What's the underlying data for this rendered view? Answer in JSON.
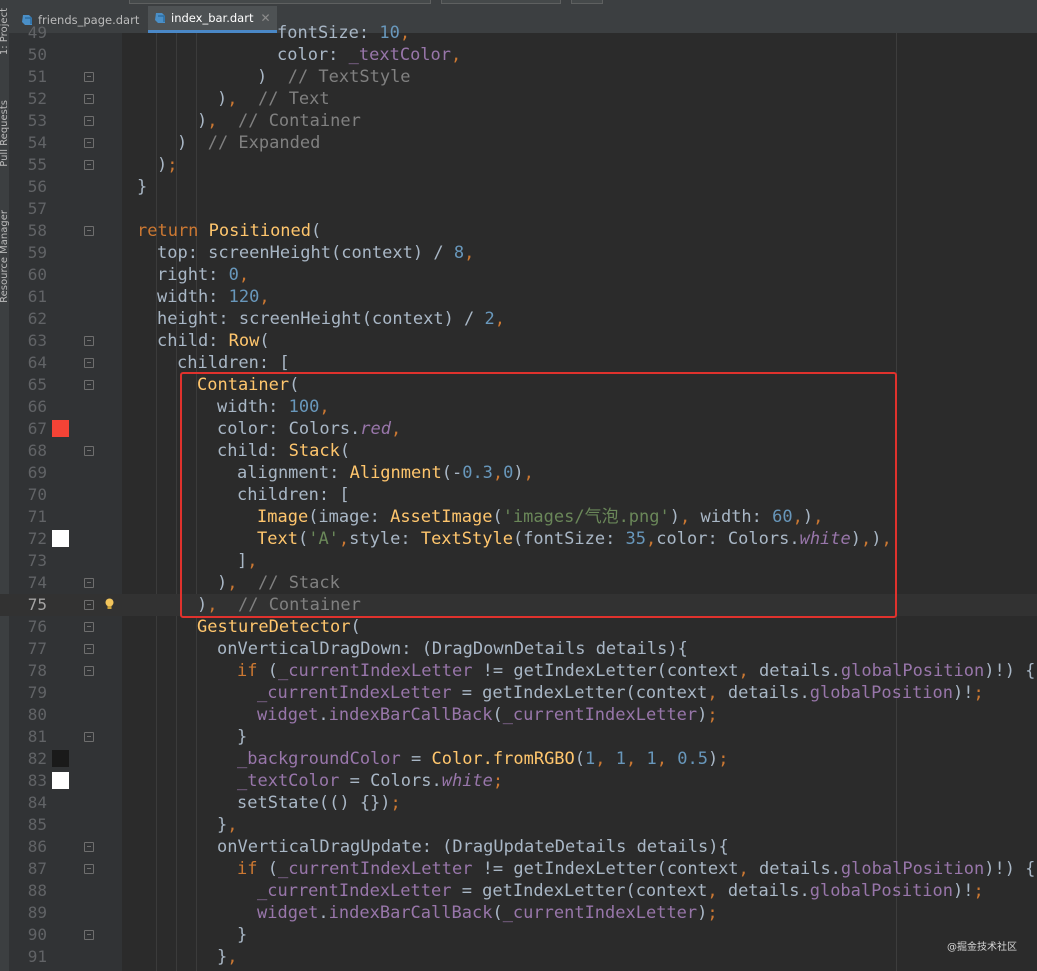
{
  "tool_window_labels": [
    "1: Project",
    "Pull Requests",
    "Resource Manager"
  ],
  "tabs": [
    {
      "label": "friends_page.dart",
      "active": false
    },
    {
      "label": "index_bar.dart",
      "active": true
    }
  ],
  "lines": [
    {
      "num": "49",
      "text": "            fontSize: 10,"
    },
    {
      "num": "50",
      "text": "            color: _textColor,"
    },
    {
      "num": "51",
      "text": "          )  // TextStyle"
    },
    {
      "num": "52",
      "text": "        ),  // Text"
    },
    {
      "num": "53",
      "text": "      ),  // Container"
    },
    {
      "num": "54",
      "text": "    )  // Expanded"
    },
    {
      "num": "55",
      "text": "  );"
    },
    {
      "num": "56",
      "text": "}"
    },
    {
      "num": "57",
      "text": ""
    },
    {
      "num": "58",
      "text": "return Positioned("
    },
    {
      "num": "59",
      "text": "  top: screenHeight(context) / 8,"
    },
    {
      "num": "60",
      "text": "  right: 0,"
    },
    {
      "num": "61",
      "text": "  width: 120,"
    },
    {
      "num": "62",
      "text": "  height: screenHeight(context) / 2,"
    },
    {
      "num": "63",
      "text": "  child: Row("
    },
    {
      "num": "64",
      "text": "    children: ["
    },
    {
      "num": "65",
      "text": "      Container("
    },
    {
      "num": "66",
      "text": "        width: 100,"
    },
    {
      "num": "67",
      "text": "        color: Colors.red,"
    },
    {
      "num": "68",
      "text": "        child: Stack("
    },
    {
      "num": "69",
      "text": "          alignment: Alignment(-0.3,0),"
    },
    {
      "num": "70",
      "text": "          children: ["
    },
    {
      "num": "71",
      "text": "            Image(image: AssetImage('images/气泡.png'), width: 60,),"
    },
    {
      "num": "72",
      "text": "            Text('A',style: TextStyle(fontSize: 35,color: Colors.white),),"
    },
    {
      "num": "73",
      "text": "          ],"
    },
    {
      "num": "74",
      "text": "        ),  // Stack"
    },
    {
      "num": "75",
      "text": "      ),  // Container"
    },
    {
      "num": "76",
      "text": "      GestureDetector("
    },
    {
      "num": "77",
      "text": "        onVerticalDragDown: (DragDownDetails details){"
    },
    {
      "num": "78",
      "text": "          if (_currentIndexLetter != getIndexLetter(context, details.globalPosition)!) {"
    },
    {
      "num": "79",
      "text": "            _currentIndexLetter = getIndexLetter(context, details.globalPosition)!;"
    },
    {
      "num": "80",
      "text": "            widget.indexBarCallBack(_currentIndexLetter);"
    },
    {
      "num": "81",
      "text": "          }"
    },
    {
      "num": "82",
      "text": "          _backgroundColor = Color.fromRGBO(1, 1, 1, 0.5);"
    },
    {
      "num": "83",
      "text": "          _textColor = Colors.white;"
    },
    {
      "num": "84",
      "text": "          setState(() {});"
    },
    {
      "num": "85",
      "text": "        },"
    },
    {
      "num": "86",
      "text": "        onVerticalDragUpdate: (DragUpdateDetails details){"
    },
    {
      "num": "87",
      "text": "          if (_currentIndexLetter != getIndexLetter(context, details.globalPosition)!) {"
    },
    {
      "num": "88",
      "text": "            _currentIndexLetter = getIndexLetter(context, details.globalPosition)!;"
    },
    {
      "num": "89",
      "text": "            widget.indexBarCallBack(_currentIndexLetter);"
    },
    {
      "num": "90",
      "text": "          }"
    },
    {
      "num": "91",
      "text": "        },"
    }
  ],
  "current_line": "75",
  "color_swatches": [
    {
      "line": "67",
      "color": "#f44336"
    },
    {
      "line": "72",
      "color": "#ffffff"
    },
    {
      "line": "82",
      "color": "#1a1a1a"
    },
    {
      "line": "83",
      "color": "#ffffff"
    }
  ],
  "colors": {
    "editor_bg": "#2b2b2b",
    "gutter_bg": "#313335",
    "highlight_box": "#e0322d",
    "keyword": "#cc7832",
    "function": "#ffc66d",
    "number": "#6897bb",
    "string": "#6a8759",
    "comment": "#808080",
    "field": "#9876aa"
  },
  "watermark": "@掘金技术社区"
}
